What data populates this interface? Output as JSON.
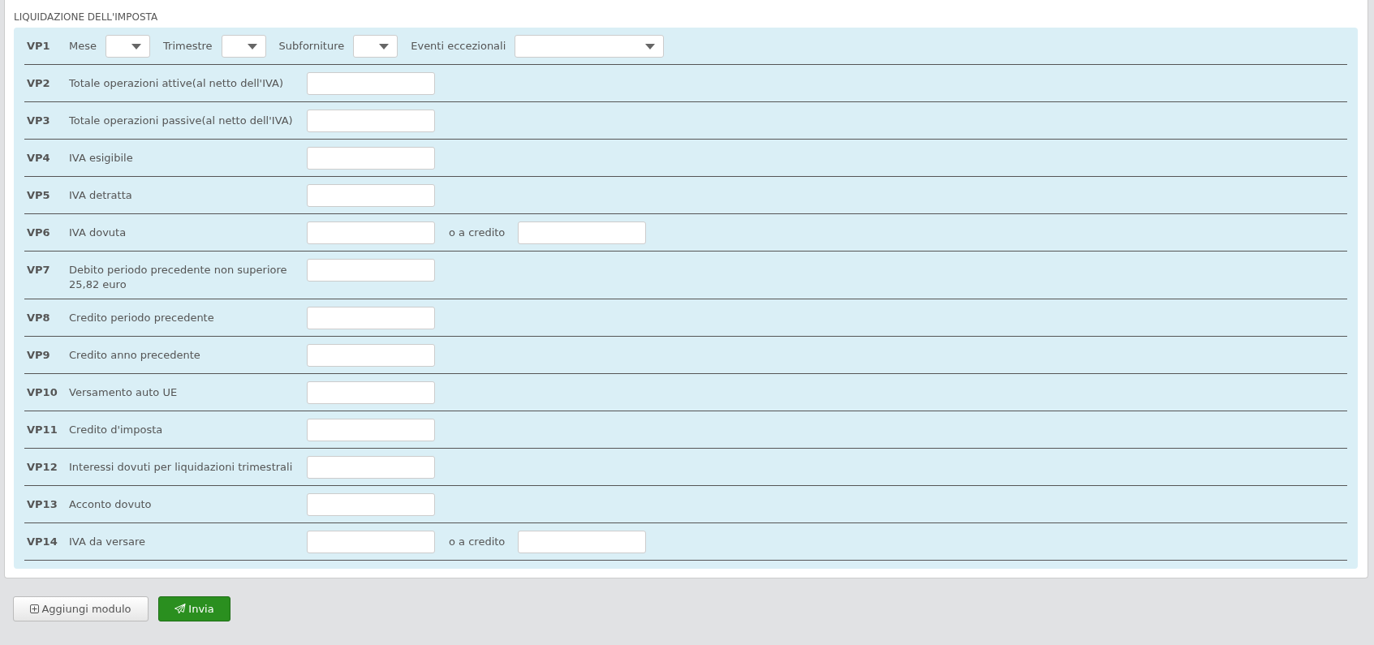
{
  "section": {
    "title": "LIQUIDAZIONE DELL'IMPOSTA"
  },
  "rows": [
    {
      "code": "VP1",
      "kind": "selects",
      "selects": [
        {
          "label": "Mese",
          "wide": false
        },
        {
          "label": "Trimestre",
          "wide": false
        },
        {
          "label": "Subforniture",
          "wide": false
        },
        {
          "label": "Eventi eccezionali",
          "wide": true
        }
      ]
    },
    {
      "code": "VP2",
      "kind": "inputs",
      "label": "Totale operazioni attive(al netto dell'IVA)"
    },
    {
      "code": "VP3",
      "kind": "inputs",
      "label": "Totale operazioni passive(al netto dell'IVA)"
    },
    {
      "code": "VP4",
      "kind": "inputs",
      "label": "IVA esigibile"
    },
    {
      "code": "VP5",
      "kind": "inputs",
      "label": "IVA detratta"
    },
    {
      "code": "VP6",
      "kind": "inputs",
      "label": "IVA dovuta",
      "extra_label": "o a credito"
    },
    {
      "code": "VP7",
      "kind": "inputs",
      "label": "Debito periodo precedente non superiore 25,82 euro"
    },
    {
      "code": "VP8",
      "kind": "inputs",
      "label": "Credito periodo precedente"
    },
    {
      "code": "VP9",
      "kind": "inputs",
      "label": "Credito anno precedente"
    },
    {
      "code": "VP10",
      "kind": "inputs",
      "label": "Versamento auto UE"
    },
    {
      "code": "VP11",
      "kind": "inputs",
      "label": "Credito d'imposta"
    },
    {
      "code": "VP12",
      "kind": "inputs",
      "label": "Interessi dovuti per liquidazioni trimestrali"
    },
    {
      "code": "VP13",
      "kind": "inputs",
      "label": "Acconto dovuto"
    },
    {
      "code": "VP14",
      "kind": "inputs",
      "label": "IVA da versare",
      "extra_label": "o a credito"
    }
  ],
  "buttons": [
    {
      "label": "Aggiungi modulo",
      "kind": "add"
    },
    {
      "label": "Invia",
      "kind": "send"
    }
  ]
}
